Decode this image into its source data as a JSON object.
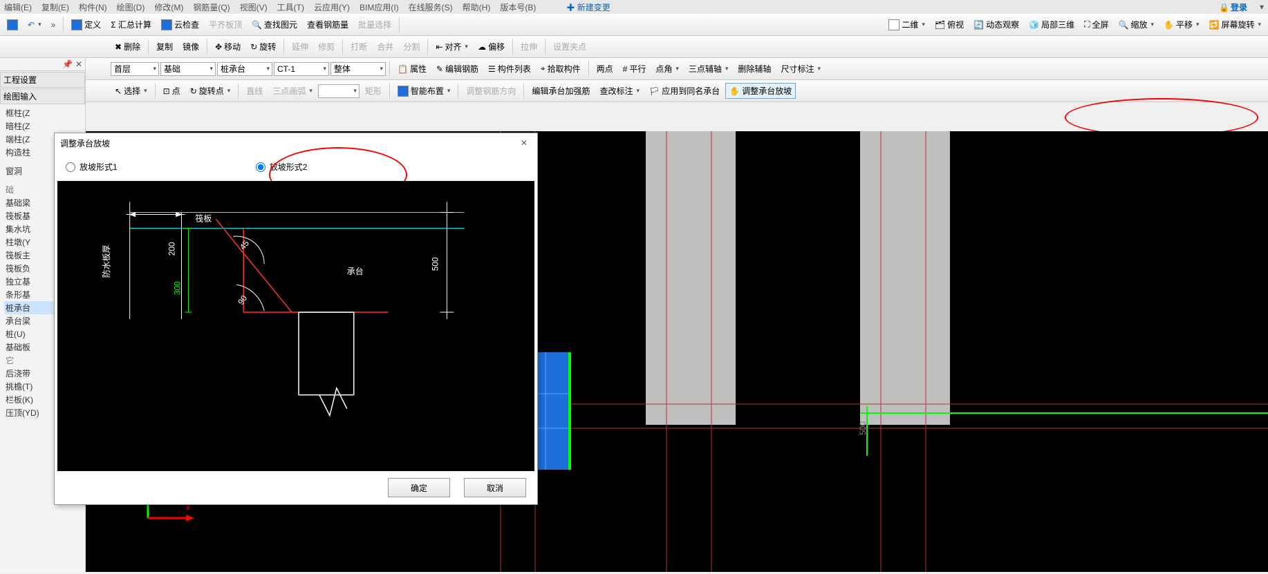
{
  "menubar": {
    "items": [
      "编辑(E)",
      "复制(E)",
      "构件(N)",
      "绘图(D)",
      "修改(M)",
      "钢筋量(Q)",
      "视图(V)",
      "工具(T)",
      "云应用(Y)",
      "BIM应用(I)",
      "在线服务(S)",
      "帮助(H)",
      "版本号(B)"
    ],
    "new_change": "新建变更",
    "login": "登录"
  },
  "ribbon1": {
    "save": "保存",
    "define": "定义",
    "sum": "Σ 汇总计算",
    "cloud": "云检查",
    "flat": "平齐板顶",
    "find": "查找图元",
    "rebar": "查看钢筋量",
    "batch": "批量选择",
    "twoD": "二维",
    "overlook": "俯视",
    "dynview": "动态观察",
    "local3d": "局部三维",
    "full": "全屏",
    "zoom": "缩放",
    "pan": "平移",
    "scrrot": "屏幕旋转"
  },
  "ribbon2": {
    "del": "删除",
    "copy": "复制",
    "mirror": "镜像",
    "move": "移动",
    "rotate": "旋转",
    "extend": "延伸",
    "trim": "修剪",
    "break": "打断",
    "merge": "合并",
    "split": "分割",
    "align": "对齐",
    "offset": "偏移",
    "stretch": "拉伸",
    "grip": "设置夹点"
  },
  "ribbon3": {
    "floor": "首层",
    "cat": "基础",
    "sub": "桩承台",
    "code": "CT-1",
    "mode": "整体",
    "attr": "属性",
    "editbar": "编辑钢筋",
    "list": "构件列表",
    "pick": "拾取构件",
    "twoPt": "两点",
    "parallel": "平行",
    "angle": "点角",
    "threeAux": "三点辅轴",
    "delAux": "删除辅轴",
    "dim": "尺寸标注"
  },
  "ribbon4": {
    "select": "选择",
    "point": "点",
    "rotpt": "旋转点",
    "line": "直线",
    "arc3": "三点画弧",
    "rect": "矩形",
    "smart": "智能布置",
    "adjbar": "调整钢筋方向",
    "editcap": "编辑承台加强筋",
    "chgmark": "查改标注",
    "apply": "应用到同名承台",
    "slope": "调整承台放坡"
  },
  "sidebar": {
    "eng": "工程设置",
    "cad": "绘图输入",
    "items": [
      "框柱(Z",
      "暗柱(Z",
      "端柱(Z",
      "构造柱",
      "窗洞",
      "础",
      "基础梁",
      "筏板基",
      "集水坑",
      "柱墩(Y",
      "筏板主",
      "筏板负",
      "独立基",
      "条形基",
      "桩承台",
      "承台梁",
      "桩(U)",
      "基础板",
      "它",
      "后浇带",
      "挑檐(T)",
      "栏板(K)",
      "压顶(YD)"
    ],
    "sel_index": 14
  },
  "dialog": {
    "title": "调整承台放坡",
    "r1": "放坡形式1",
    "r2": "放坡形式2",
    "ok": "确定",
    "cancel": "取消",
    "labels": {
      "raft": "筏板",
      "cap": "承台",
      "waterproof": "防水板厚",
      "d200": "200",
      "d300": "300",
      "d45": "45",
      "d90": "90",
      "d500": "500"
    }
  }
}
